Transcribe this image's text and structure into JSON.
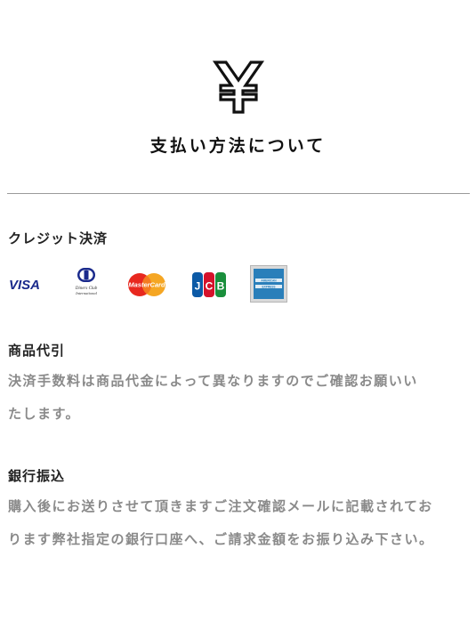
{
  "header": {
    "icon": "yen-icon",
    "title": "支払い方法について"
  },
  "sections": {
    "credit": {
      "heading": "クレジット決済",
      "cards": [
        {
          "name": "VISA",
          "label": "VISA",
          "icon": "visa-logo-icon",
          "color": "#1a2a8c"
        },
        {
          "name": "Diners Club International",
          "label": "Diners Club International",
          "icon": "diners-club-logo-icon",
          "color": "#1a2a8c"
        },
        {
          "name": "MasterCard",
          "label": "MasterCard",
          "icon": "mastercard-logo-icon",
          "color": "#e8281f"
        },
        {
          "name": "JCB",
          "label": "JCB",
          "icon": "jcb-logo-icon",
          "color": "#0c5aa6"
        },
        {
          "name": "American Express",
          "label": "AMERICAN EXPRESS",
          "icon": "amex-logo-icon",
          "color": "#2a7fba"
        }
      ]
    },
    "cod": {
      "heading": "商品代引",
      "lines": [
        "決済手数料は商品代金によって異なりますのでご確認お願いい",
        "たします。"
      ]
    },
    "bank": {
      "heading": "銀行振込",
      "lines": [
        "購入後にお送りさせて頂きますご注文確認メールに記載されてお",
        "ります弊社指定の銀行口座へ、ご請求金額をお振り込み下さい。"
      ]
    }
  },
  "colors": {
    "heading": "#222222",
    "body_text": "#8a8a8a",
    "divider": "#9a9a9a"
  }
}
